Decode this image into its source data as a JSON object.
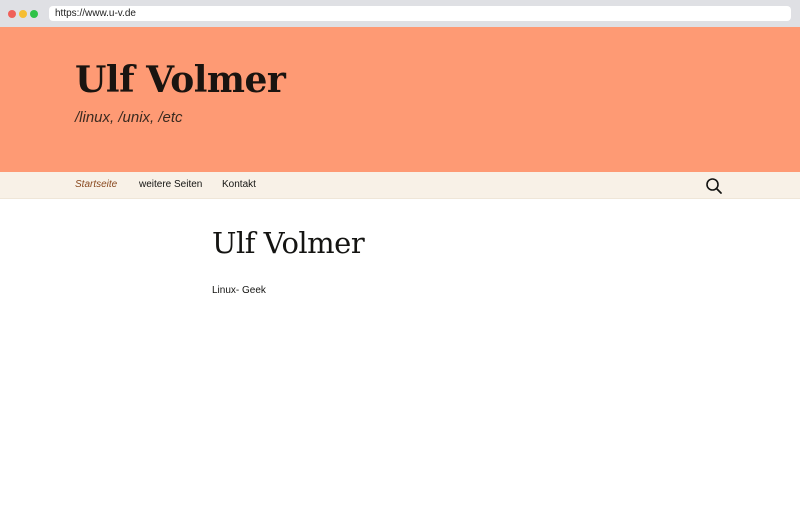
{
  "browser": {
    "url": "https://www.u-v.de"
  },
  "header": {
    "site_title": "Ulf Volmer",
    "site_description": "/linux, /unix, /etc",
    "background_color": "#fe9a74"
  },
  "nav": {
    "items": [
      {
        "label": "Startseite",
        "current": true
      },
      {
        "label": "weitere Seiten",
        "current": false
      },
      {
        "label": "Kontakt",
        "current": false
      }
    ],
    "search_icon": "search-icon",
    "background_color": "#f8f1e7"
  },
  "main": {
    "title": "Ulf Volmer",
    "content": "Linux- Geek"
  }
}
